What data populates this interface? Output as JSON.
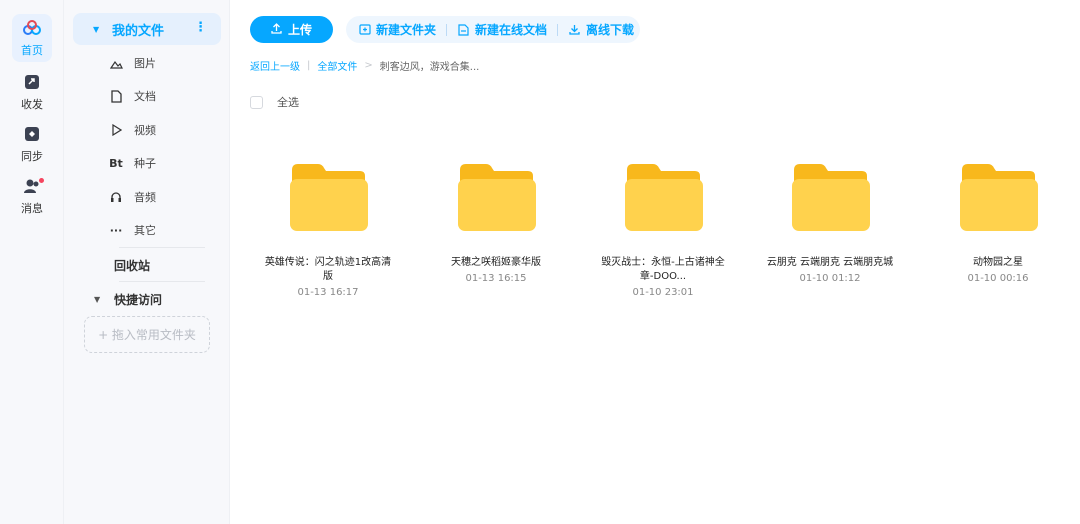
{
  "rail": {
    "items": [
      {
        "label": "首页",
        "icon": "baidu-netdisk-logo-icon",
        "active": true
      },
      {
        "label": "收发",
        "icon": "share-arrow-icon"
      },
      {
        "label": "同步",
        "icon": "sync-icon"
      },
      {
        "label": "消息",
        "icon": "people-icon",
        "has_badge": true
      }
    ]
  },
  "sidebar": {
    "my_files": "我的文件",
    "more_icon": "⋮",
    "sub_items": [
      {
        "label": "图片",
        "icon": "image-icon"
      },
      {
        "label": "文档",
        "icon": "document-icon"
      },
      {
        "label": "视频",
        "icon": "video-play-icon"
      },
      {
        "label": "种子",
        "icon": "bt-icon",
        "icon_text": "Bt"
      },
      {
        "label": "音频",
        "icon": "headphone-icon"
      },
      {
        "label": "其它",
        "icon": "more-dots-icon",
        "icon_text": "···"
      }
    ],
    "recycle": "回收站",
    "quick_access": "快捷访问",
    "drop_zone": "+ 拖入常用文件夹"
  },
  "toolbar": {
    "upload": "上传",
    "new_folder": "新建文件夹",
    "new_online_doc": "新建在线文档",
    "offline_download": "离线下载"
  },
  "breadcrumb": {
    "back": "返回上一级",
    "sep1": "|",
    "all_files": "全部文件",
    "sep2": ">",
    "current": "刺客边风，游戏合集..."
  },
  "select_all": "全选",
  "files": [
    {
      "name": "英雄传说：闪之轨迹1改高清版",
      "time": "01-13 16:17"
    },
    {
      "name": "天穗之咲稻姬豪华版",
      "time": "01-13 16:15"
    },
    {
      "name": "毁灭战士：永恒-上古诸神全章-DOO...",
      "time": "01-10 23:01"
    },
    {
      "name": "云朋克 云端朋克 云端朋克城",
      "time": "01-10 01:12"
    },
    {
      "name": "动物园之星",
      "time": "01-10 00:16"
    }
  ],
  "colors": {
    "accent": "#06a7ff",
    "folder_back": "#f8b81c",
    "folder_front": "#ffd24d",
    "badge": "#f5455f"
  }
}
